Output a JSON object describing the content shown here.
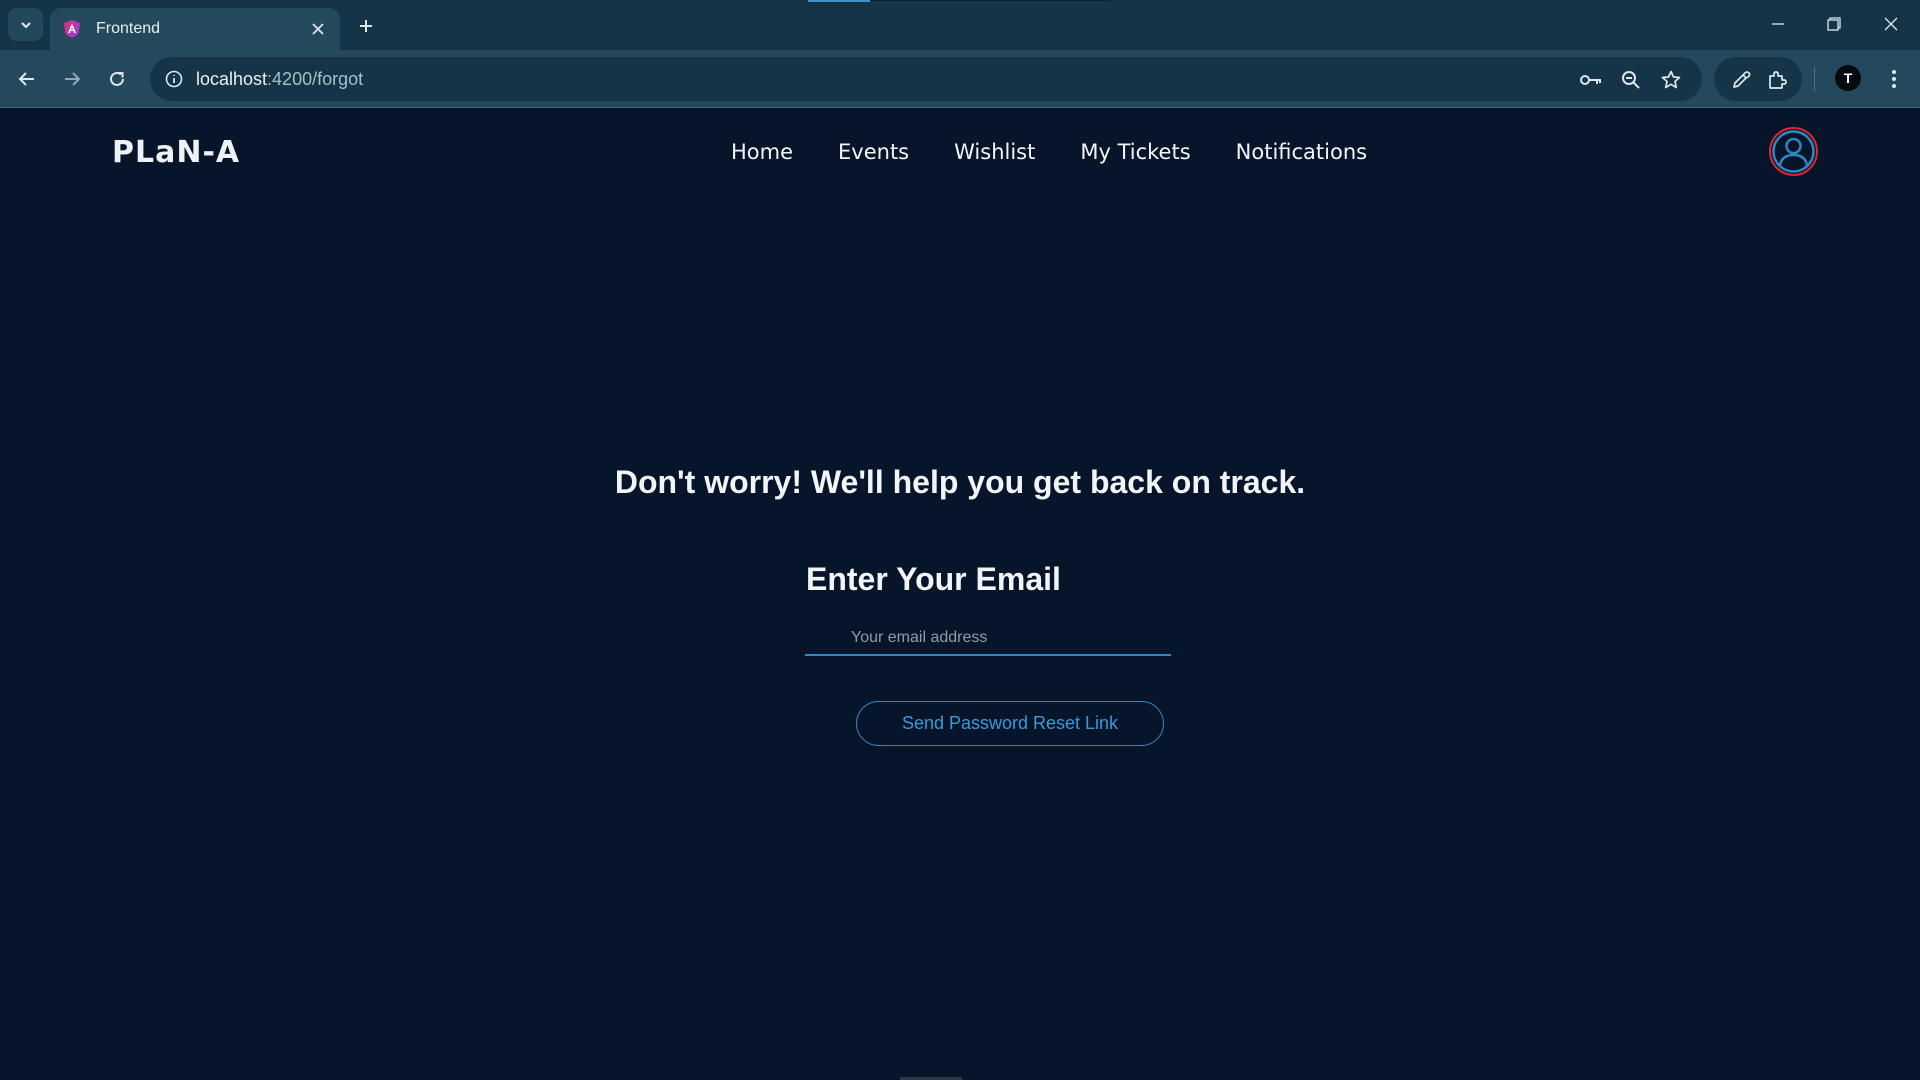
{
  "browser": {
    "tab_title": "Frontend",
    "url_host": "localhost",
    "url_path": ":4200/forgot",
    "profile_initial": "T"
  },
  "icons": {
    "tab_search": "chevron-down-icon",
    "favicon": "angular-icon",
    "close": "close-icon",
    "new_tab": "plus-icon",
    "back": "arrow-left-icon",
    "forward": "arrow-right-icon",
    "reload": "reload-icon",
    "site_info": "info-icon",
    "password": "key-icon",
    "zoom": "zoom-out-icon",
    "bookmark": "star-icon",
    "eyedropper": "eyedropper-icon",
    "extensions": "puzzle-icon",
    "menu": "more-vertical-icon",
    "user": "user-icon"
  },
  "site": {
    "logo": "PLaN-A",
    "nav": [
      "Home",
      "Events",
      "Wishlist",
      "My Tickets",
      "Notifications"
    ]
  },
  "main": {
    "headline": "Don't worry! We'll help you get back on track.",
    "subhead": "Enter Your Email",
    "email_placeholder": "Your email address",
    "email_value": "",
    "button_label": "Send Password Reset Link"
  },
  "colors": {
    "page_bg": "#07152a",
    "accent": "#2e86c4",
    "avatar_ring": "#e0262e"
  }
}
